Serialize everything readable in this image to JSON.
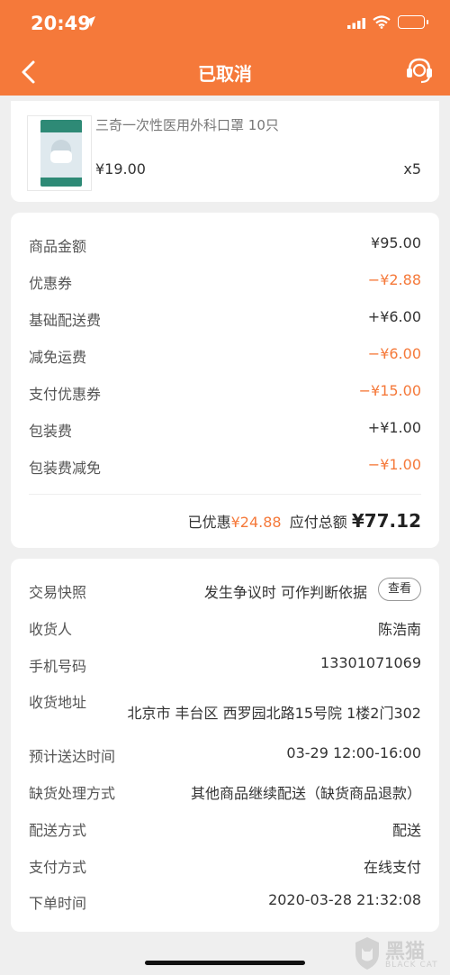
{
  "status_bar": {
    "time": "20:49"
  },
  "nav": {
    "title": "已取消"
  },
  "product": {
    "name": "三奇一次性医用外科口罩 10只",
    "price": "¥19.00",
    "quantity": "x5"
  },
  "fees": [
    {
      "label": "商品金额",
      "value": "¥95.00",
      "highlight": false
    },
    {
      "label": "优惠券",
      "value": "−¥2.88",
      "highlight": true
    },
    {
      "label": "基础配送费",
      "value": "+¥6.00",
      "highlight": false
    },
    {
      "label": "减免运费",
      "value": "−¥6.00",
      "highlight": true
    },
    {
      "label": "支付优惠券",
      "value": "−¥15.00",
      "highlight": true
    },
    {
      "label": "包装费",
      "value": "+¥1.00",
      "highlight": false
    },
    {
      "label": "包装费减免",
      "value": "−¥1.00",
      "highlight": true
    }
  ],
  "totals": {
    "discount_label": "已优惠",
    "discount_value": "¥24.88",
    "payable_label": "应付总额",
    "payable_value": "¥77.12"
  },
  "order_info": {
    "snapshot": {
      "label": "交易快照",
      "value": "发生争议时 可作判断依据",
      "button": "查看"
    },
    "recipient": {
      "label": "收货人",
      "value": "陈浩南"
    },
    "phone": {
      "label": "手机号码",
      "value": "13301071069"
    },
    "address": {
      "label": "收货地址",
      "value": "北京市 丰台区 西罗园北路15号院 1楼2门302"
    },
    "eta": {
      "label": "预计送达时间",
      "value": "03-29 12:00-16:00"
    },
    "stockout": {
      "label": "缺货处理方式",
      "value": "其他商品继续配送（缺货商品退款）"
    },
    "delivery": {
      "label": "配送方式",
      "value": "配送"
    },
    "payment": {
      "label": "支付方式",
      "value": "在线支付"
    },
    "order_time": {
      "label": "下单时间",
      "value": "2020-03-28 21:32:08"
    }
  },
  "watermark": {
    "cn": "黑猫",
    "en": "BLACK CAT"
  },
  "colors": {
    "accent": "#f5793a",
    "background": "#efefef"
  }
}
